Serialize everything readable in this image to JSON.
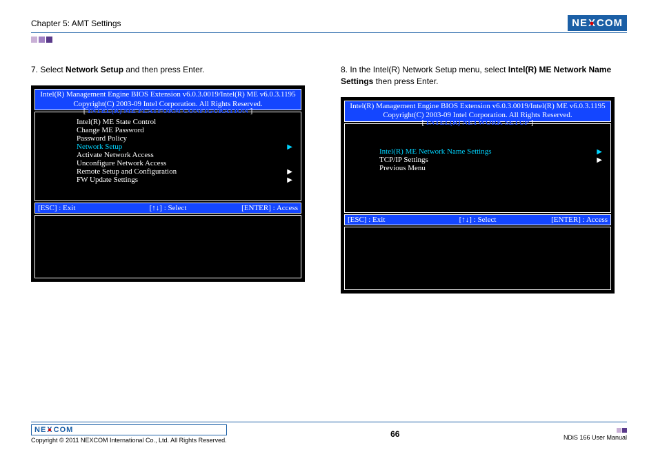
{
  "header": {
    "chapter": "Chapter 5: AMT Settings",
    "logo_pre": "NE",
    "logo_x": "X",
    "logo_post": "COM"
  },
  "steps": {
    "left_num": "7. ",
    "left_pre": "Select ",
    "left_bold": "Network Setup",
    "left_post": " and then press Enter.",
    "right_num": "8. ",
    "right_pre": "In the Intel(R) Network Setup menu, select ",
    "right_bold": "Intel(R) ME Network Name Settings",
    "right_post": " then press Enter."
  },
  "bios_common": {
    "hdr1": "Intel(R) Management Engine BIOS Extension v6.0.3.0019/Intel(R) ME v6.0.3.1195",
    "hdr2": "Copyright(C) 2003-09 Intel Corporation. All Rights Reserved.",
    "keys_esc": "[ESC] : Exit",
    "keys_sel": "[↑↓] : Select",
    "keys_ent": "[ENTER] : Access"
  },
  "bios_left": {
    "title": "INTEL(R) ME PLATFORM CONFIGURATION",
    "items": [
      {
        "label": "Intel(R) ME State Control",
        "arrow": false,
        "selected": false
      },
      {
        "label": "Change ME Password",
        "arrow": false,
        "selected": false
      },
      {
        "label": "Password Policy",
        "arrow": false,
        "selected": false
      },
      {
        "label": "Network Setup",
        "arrow": true,
        "selected": true
      },
      {
        "label": "Activate Network Access",
        "arrow": false,
        "selected": false
      },
      {
        "label": "Unconfigure Network Access",
        "arrow": false,
        "selected": false
      },
      {
        "label": "Remote Setup and Configuration",
        "arrow": true,
        "selected": false
      },
      {
        "label": "FW Update Settings",
        "arrow": true,
        "selected": false
      }
    ]
  },
  "bios_right": {
    "title": "INTEL(R) NETWORK SETUP",
    "items": [
      {
        "label": "Intel(R) ME Network Name Settings",
        "arrow": true,
        "selected": true
      },
      {
        "label": "TCP/IP Settings",
        "arrow": true,
        "selected": false
      },
      {
        "label": "Previous Menu",
        "arrow": false,
        "selected": false
      }
    ]
  },
  "footer": {
    "copyright": "Copyright © 2011 NEXCOM International Co., Ltd. All Rights Reserved.",
    "page": "66",
    "manual": "NDiS 166 User Manual"
  }
}
